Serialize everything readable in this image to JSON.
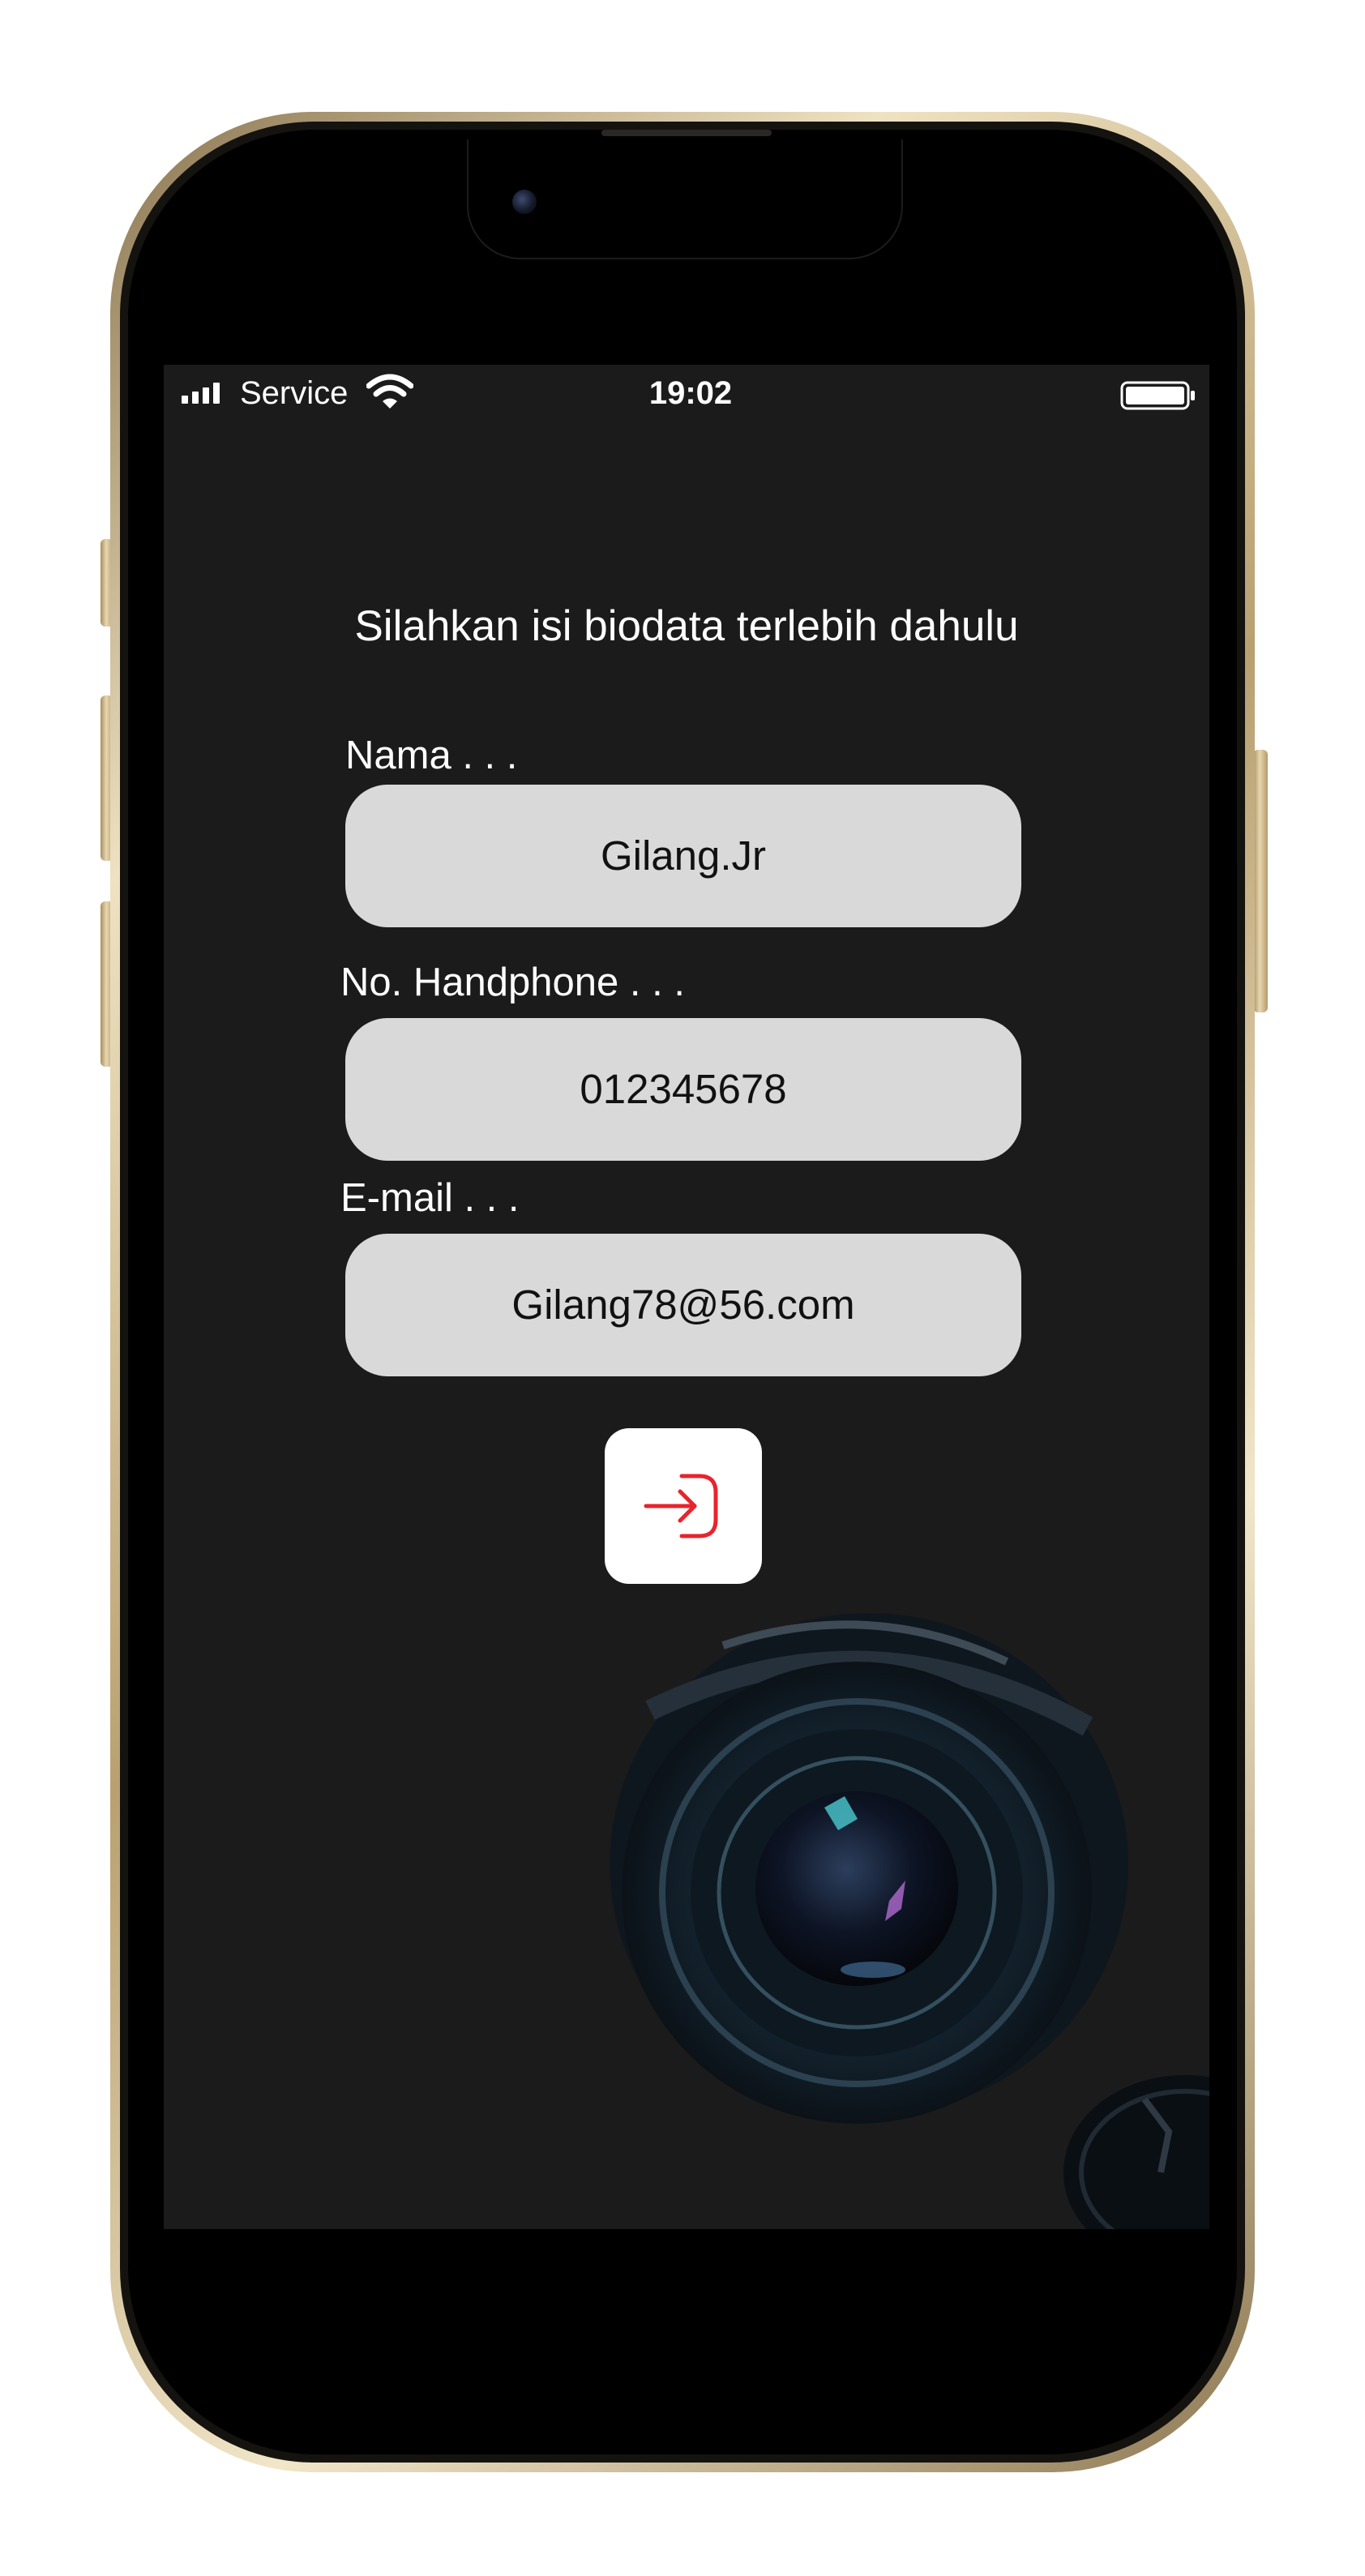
{
  "status_bar": {
    "carrier": "Service",
    "time": "19:02",
    "icons": [
      "signal-icon",
      "wifi-icon",
      "battery-icon"
    ]
  },
  "form": {
    "prompt": "Silahkan isi biodata terlebih dahulu",
    "fields": [
      {
        "label": "Nama . . .",
        "value": "Gilang.Jr"
      },
      {
        "label": "No. Handphone . . .",
        "value": "012345678"
      },
      {
        "label": "E-mail . . .",
        "value": "Gilang78@56.com"
      }
    ],
    "submit_icon": "login-icon"
  },
  "colors": {
    "screen_background": "#1b1b1b",
    "field_background": "#d9d9d9",
    "accent_icon": "#e8242c",
    "phone_frame_gold": "#d9c69c"
  },
  "image": {
    "subject": "camera-lens-photo"
  }
}
